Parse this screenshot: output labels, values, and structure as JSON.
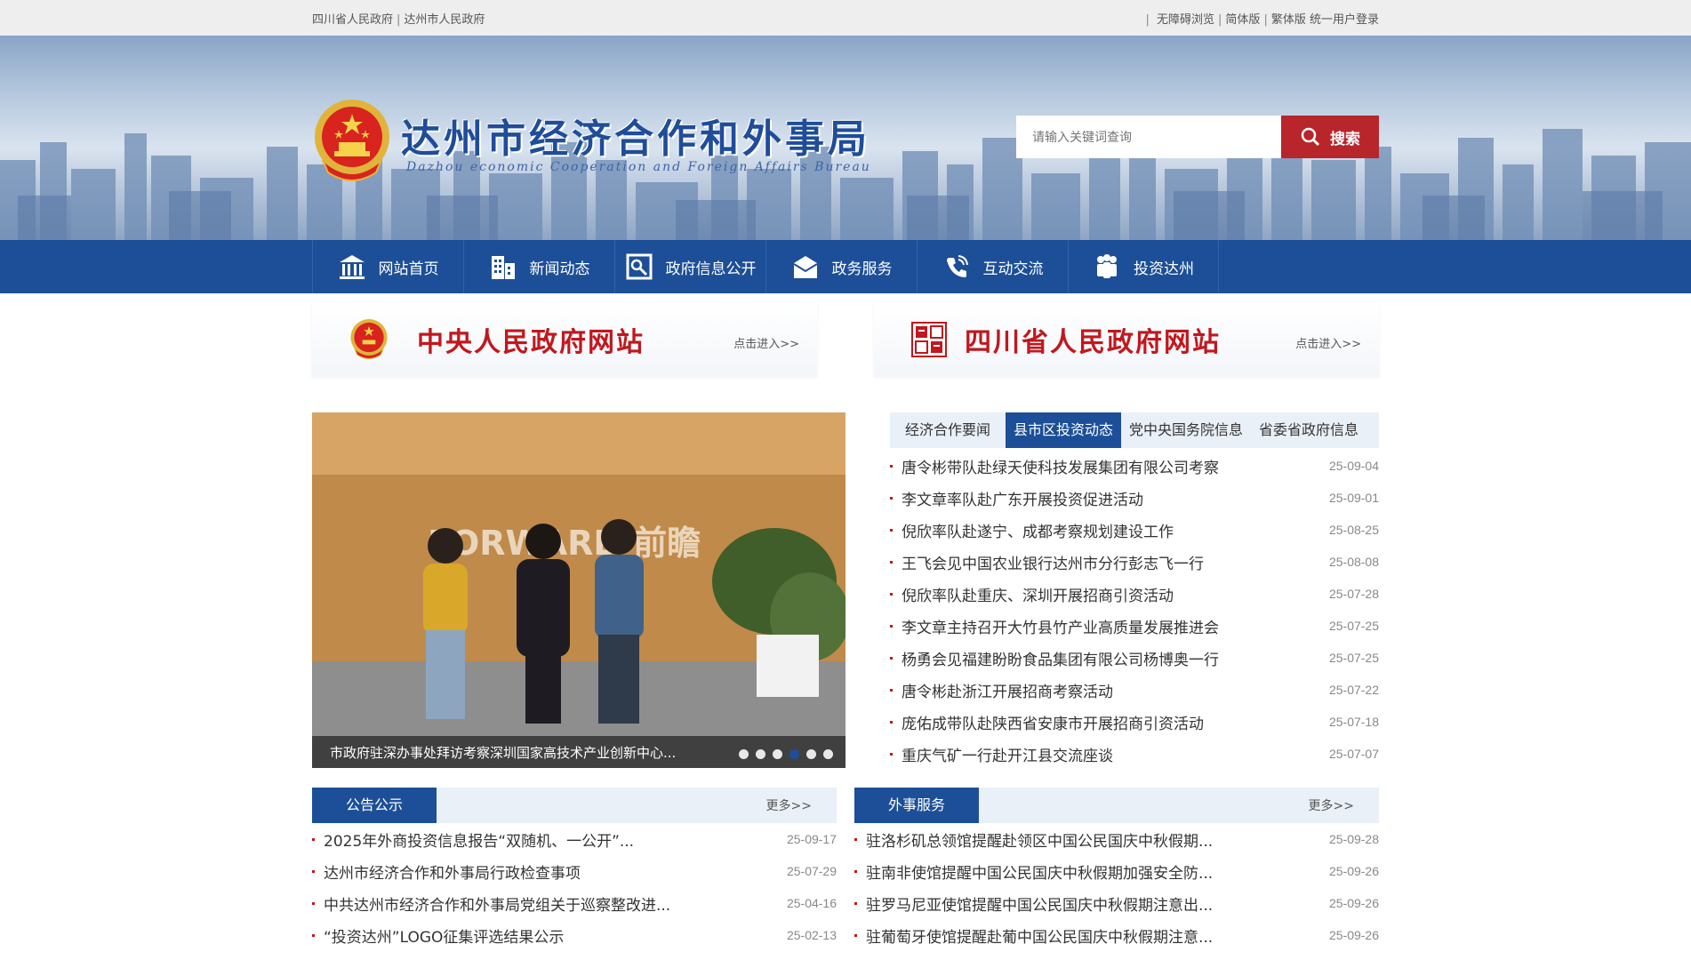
{
  "topbar": {
    "left_links": [
      "四川省人民政府",
      "达州市人民政府"
    ],
    "right_links": [
      "无障碍浏览",
      "简体版",
      "繁体版",
      "统一用户登录"
    ]
  },
  "header": {
    "title": "达州市经济合作和外事局",
    "subtitle": "Dazhou economic Cooperation and Foreign Affairs Bureau",
    "search_placeholder": "请输入关键词查询",
    "search_button": "搜索"
  },
  "nav": {
    "items": [
      {
        "label": "网站首页",
        "icon": "home-icon"
      },
      {
        "label": "新闻动态",
        "icon": "building-icon"
      },
      {
        "label": "政府信息公开",
        "icon": "document-icon"
      },
      {
        "label": "政务服务",
        "icon": "envelope-icon"
      },
      {
        "label": "互动交流",
        "icon": "phone-icon"
      },
      {
        "label": "投资达州",
        "icon": "people-icon"
      }
    ]
  },
  "gov_links": [
    {
      "title": "中央人民政府网站",
      "enter": "点击进入>>"
    },
    {
      "title": "四川省人民政府网站",
      "enter": "点击进入>>"
    }
  ],
  "slider": {
    "photo_sign": "FORWARD 前瞻",
    "caption": "市政府驻深办事处拜访考察深圳国家高技术产业创新中心...",
    "dot_count": 6,
    "active_dot": 3
  },
  "news": {
    "tabs": [
      "经济合作要闻",
      "县市区投资动态",
      "党中央国务院信息",
      "省委省政府信息"
    ],
    "active_tab": 1,
    "items": [
      {
        "title": "唐令彬带队赴绿天使科技发展集团有限公司考察",
        "date": "25-09-04"
      },
      {
        "title": "李文章率队赴广东开展投资促进活动",
        "date": "25-09-01"
      },
      {
        "title": "倪欣率队赴遂宁、成都考察规划建设工作",
        "date": "25-08-25"
      },
      {
        "title": "王飞会见中国农业银行达州市分行彭志飞一行",
        "date": "25-08-08"
      },
      {
        "title": "倪欣率队赴重庆、深圳开展招商引资活动",
        "date": "25-07-28"
      },
      {
        "title": "李文章主持召开大竹县竹产业高质量发展推进会",
        "date": "25-07-25"
      },
      {
        "title": "杨勇会见福建盼盼食品集团有限公司杨博奥一行",
        "date": "25-07-25"
      },
      {
        "title": "唐令彬赴浙江开展招商考察活动",
        "date": "25-07-22"
      },
      {
        "title": "庞佑成带队赴陕西省安康市开展招商引资活动",
        "date": "25-07-18"
      },
      {
        "title": "重庆气矿一行赴开江县交流座谈",
        "date": "25-07-07"
      }
    ]
  },
  "notices": {
    "title": "公告公示",
    "more": "更多>>",
    "items": [
      {
        "title": "2025年外商投资信息报告“双随机、一公开”...",
        "date": "25-09-17"
      },
      {
        "title": "达州市经济合作和外事局行政检查事项",
        "date": "25-07-29"
      },
      {
        "title": "中共达州市经济合作和外事局党组关于巡察整改进...",
        "date": "25-04-16"
      },
      {
        "title": "“投资达州”LOGO征集评选结果公示",
        "date": "25-02-13"
      }
    ]
  },
  "foreign": {
    "title": "外事服务",
    "more": "更多>>",
    "items": [
      {
        "title": "驻洛杉矶总领馆提醒赴领区中国公民国庆中秋假期...",
        "date": "25-09-28"
      },
      {
        "title": "驻南非使馆提醒中国公民国庆中秋假期加强安全防...",
        "date": "25-09-26"
      },
      {
        "title": "驻罗马尼亚使馆提醒中国公民国庆中秋假期注意出...",
        "date": "25-09-26"
      },
      {
        "title": "驻葡萄牙使馆提醒赴葡中国公民国庆中秋假期注意...",
        "date": "25-09-26"
      }
    ]
  }
}
